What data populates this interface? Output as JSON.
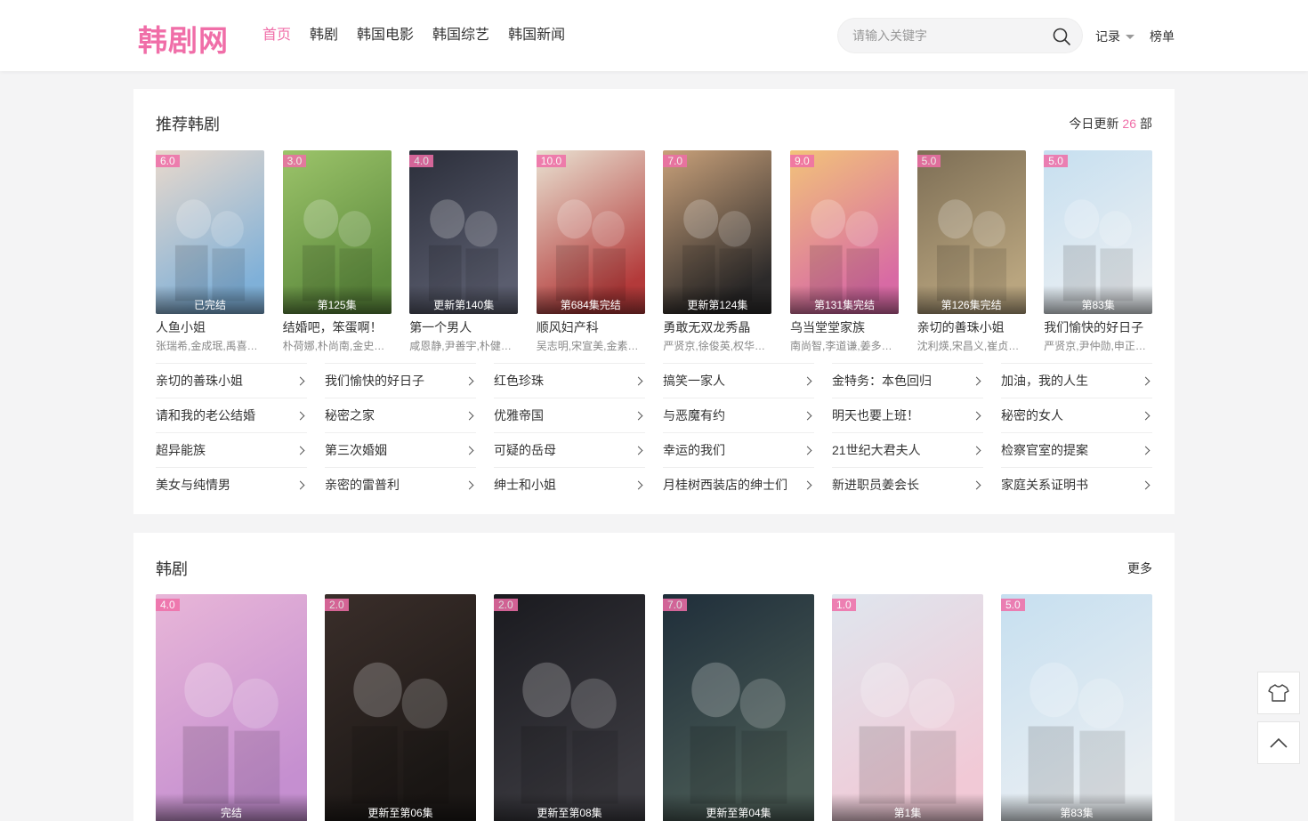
{
  "header": {
    "logo": "韩剧网",
    "nav": [
      "首页",
      "韩剧",
      "韩国电影",
      "韩国综艺",
      "韩国新闻"
    ],
    "search_placeholder": "请输入关键字",
    "history_label": "记录",
    "rank_label": "榜单"
  },
  "recommend": {
    "title": "推荐韩剧",
    "update_prefix": "今日更新",
    "update_count": "26",
    "update_suffix": "部",
    "cards": [
      {
        "score": "6.0",
        "status": "已完结",
        "name": "人鱼小姐",
        "actors": "张瑞希,金成珉,禹喜…",
        "c1": "#e9d9cc",
        "c2": "#7fb0d8"
      },
      {
        "score": "3.0",
        "status": "第125集",
        "name": "结婚吧，笨蛋啊！",
        "actors": "朴荷娜,朴尚南,金史…",
        "c1": "#9cc46a",
        "c2": "#5d8a3d"
      },
      {
        "score": "4.0",
        "status": "更新第140集",
        "name": "第一个男人",
        "actors": "咸恩静,尹善宇,朴健…",
        "c1": "#2b2e3a",
        "c2": "#5a5d6e"
      },
      {
        "score": "10.0",
        "status": "第684集完结",
        "name": "顺风妇产科",
        "actors": "吴志明,宋宣美,金素…",
        "c1": "#e9e2d2",
        "c2": "#b33a3a"
      },
      {
        "score": "7.0",
        "status": "更新第124集",
        "name": "勇敢无双龙秀晶",
        "actors": "严贤京,徐俊英,权华…",
        "c1": "#c9a17a",
        "c2": "#2c2a2a"
      },
      {
        "score": "9.0",
        "status": "第131集完结",
        "name": "乌当堂堂家族",
        "actors": "南尚智,李道谦,姜多…",
        "c1": "#f2c37a",
        "c2": "#d86aa4"
      },
      {
        "score": "5.0",
        "status": "第126集完结",
        "name": "亲切的善珠小姐",
        "actors": "沈利煐,宋昌义,崔贞…",
        "c1": "#7d6e55",
        "c2": "#b9a57f"
      },
      {
        "score": "5.0",
        "status": "第83集",
        "name": "我们愉快的好日子",
        "actors": "严贤京,尹仲勋,申正…",
        "c1": "#c6dff0",
        "c2": "#e9eef2"
      }
    ],
    "links": [
      "亲切的善珠小姐",
      "我们愉快的好日子",
      "红色珍珠",
      "搞笑一家人",
      "金特务：本色回归",
      "加油，我的人生",
      "请和我的老公结婚",
      "秘密之家",
      "优雅帝国",
      "与恶魔有约",
      "明天也要上班！",
      "秘密的女人",
      "超异能族",
      "第三次婚姻",
      "可疑的岳母",
      "幸运的我们",
      "21世纪大君夫人",
      "检察官室的提案",
      "美女与纯情男",
      "亲密的雷普利",
      "绅士和小姐",
      "月桂树西装店的绅士们",
      "新进职员姜会长",
      "家庭关系证明书"
    ]
  },
  "kdrama": {
    "title": "韩剧",
    "more": "更多",
    "cards": [
      {
        "score": "4.0",
        "status": "完结",
        "c1": "#e8b6d8",
        "c2": "#c58fd0"
      },
      {
        "score": "2.0",
        "status": "更新至第06集",
        "c1": "#3a2e2a",
        "c2": "#1c1816"
      },
      {
        "score": "2.0",
        "status": "更新至第08集",
        "c1": "#1a1a1f",
        "c2": "#3b3a40"
      },
      {
        "score": "7.0",
        "status": "更新至第04集",
        "c1": "#1f2e3a",
        "c2": "#4a5b55"
      },
      {
        "score": "1.0",
        "status": "第1集",
        "c1": "#dfe6ee",
        "c2": "#f1c9d6"
      },
      {
        "score": "5.0",
        "status": "第83集",
        "c1": "#c6dff0",
        "c2": "#e9eef2"
      }
    ]
  },
  "float": {
    "shirt_icon": "shirt-icon",
    "top_icon": "arrow-up-icon"
  }
}
